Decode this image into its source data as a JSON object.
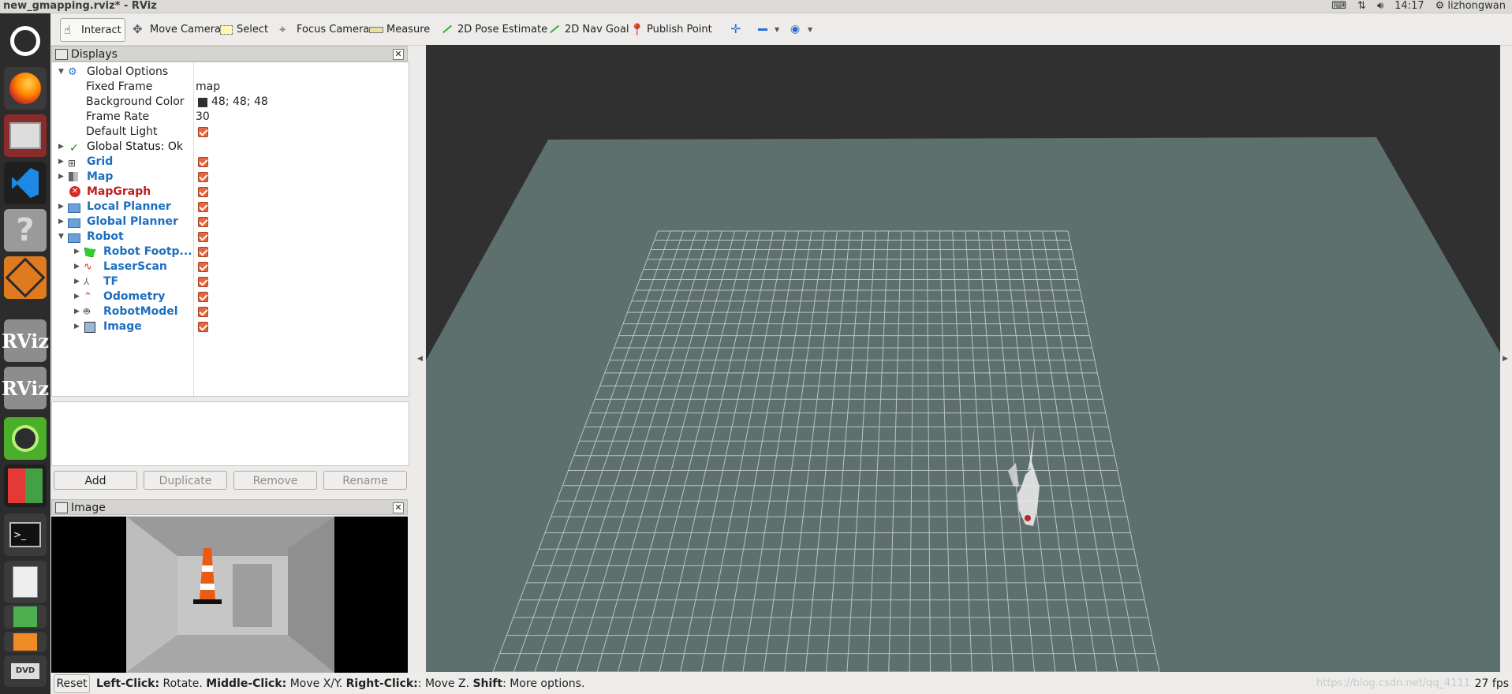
{
  "window": {
    "title": "new_gmapping.rviz* - RViz"
  },
  "tray": {
    "time": "14:17",
    "user": "lizhongwan"
  },
  "toolbar": {
    "tools": [
      {
        "label": "Interact",
        "icon": "hand-icon"
      },
      {
        "label": "Move Camera",
        "icon": "move-camera-icon"
      },
      {
        "label": "Select",
        "icon": "select-icon"
      },
      {
        "label": "Focus Camera",
        "icon": "focus-camera-icon"
      },
      {
        "label": "Measure",
        "icon": "ruler-icon"
      },
      {
        "label": "2D Pose Estimate",
        "icon": "green-arrow-icon"
      },
      {
        "label": "2D Nav Goal",
        "icon": "green-arrow-icon"
      },
      {
        "label": "Publish Point",
        "icon": "pin-icon"
      }
    ]
  },
  "displays": {
    "title": "Displays",
    "global_options": {
      "label": "Global Options",
      "fixed_frame_label": "Fixed Frame",
      "fixed_frame": "map",
      "bg_label": "Background Color",
      "bg_value": "48; 48; 48",
      "bg_color": "#303030",
      "frame_rate_label": "Frame Rate",
      "frame_rate": "30",
      "default_light_label": "Default Light"
    },
    "global_status": "Global Status: Ok",
    "items": [
      {
        "label": "Grid"
      },
      {
        "label": "Map"
      },
      {
        "label": "MapGraph"
      },
      {
        "label": "Local Planner"
      },
      {
        "label": "Global Planner"
      },
      {
        "label": "Robot"
      }
    ],
    "robot_children": [
      {
        "label": "Robot Footp..."
      },
      {
        "label": "LaserScan"
      },
      {
        "label": "TF"
      },
      {
        "label": "Odometry"
      },
      {
        "label": "RobotModel"
      },
      {
        "label": "Image"
      }
    ],
    "buttons": {
      "add": "Add",
      "duplicate": "Duplicate",
      "remove": "Remove",
      "rename": "Rename"
    }
  },
  "image_panel": {
    "title": "Image"
  },
  "status": {
    "reset": "Reset",
    "k1": "Left-Click:",
    "v1": " Rotate. ",
    "k2": "Middle-Click:",
    "v2": " Move X/Y. ",
    "k3": "Right-Click:",
    "v3": ": Move Z. ",
    "k4": "Shift",
    "v4": ": More options.",
    "fps": "27 fps",
    "watermark": "https://blog.csdn.net/qq_4111"
  }
}
